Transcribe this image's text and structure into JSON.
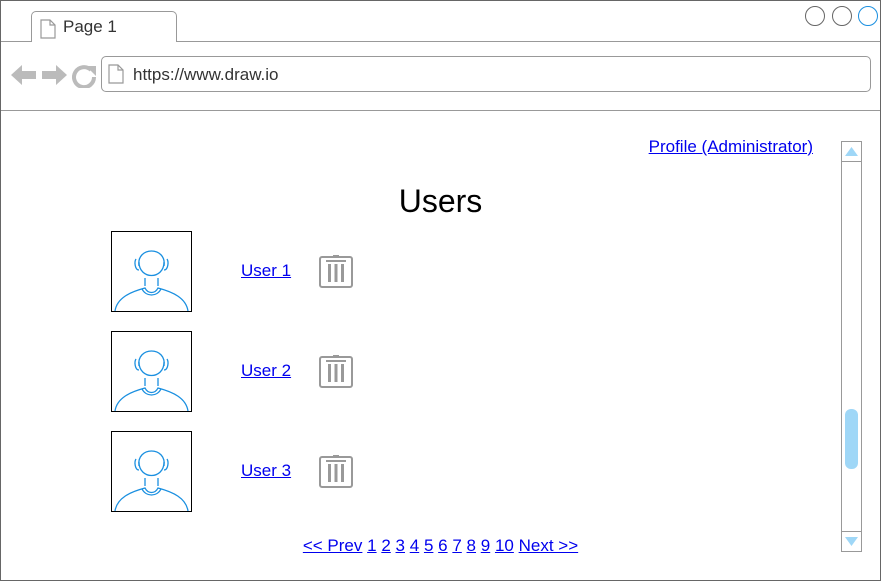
{
  "browser": {
    "tab_label": "Page 1",
    "url": "https://www.draw.io"
  },
  "header": {
    "profile_link": "Profile (Administrator)"
  },
  "page": {
    "title": "Users"
  },
  "users": [
    {
      "label": "User 1"
    },
    {
      "label": "User 2"
    },
    {
      "label": "User 3"
    }
  ],
  "pagination": {
    "prev": "<< Prev",
    "pages": [
      "1",
      "2",
      "3",
      "4",
      "5",
      "6",
      "7",
      "8",
      "9",
      "10"
    ],
    "next": "Next >>"
  },
  "icons": {
    "tab": "page-icon",
    "back": "back-arrow-icon",
    "forward": "forward-arrow-icon",
    "reload": "reload-icon",
    "url": "page-icon",
    "avatar": "user-avatar-icon",
    "delete": "trash-icon",
    "scroll_up": "triangle-up-icon",
    "scroll_down": "triangle-down-icon"
  },
  "colors": {
    "link": "#0000ee",
    "accent": "#1a8fe0",
    "scroll_thumb": "#9fd7f7",
    "icon_gray": "#999999"
  }
}
